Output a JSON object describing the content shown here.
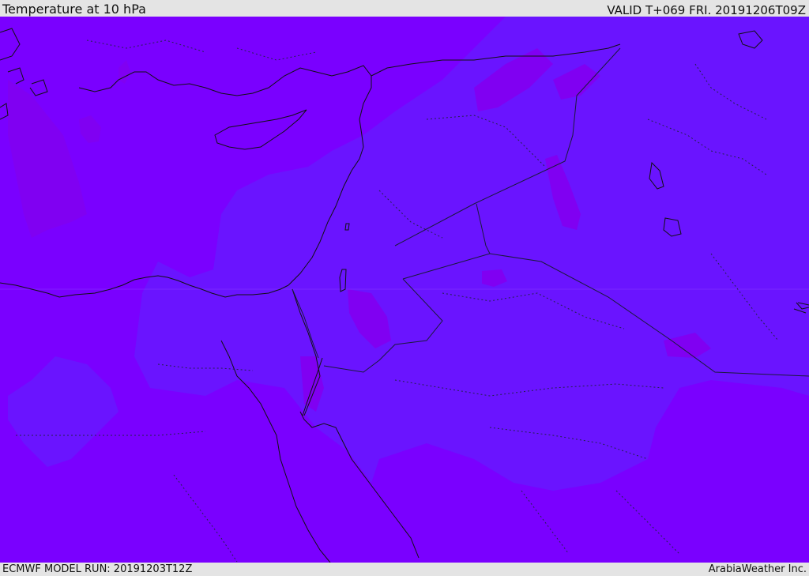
{
  "header": {
    "title": "Temperature at 10 hPa",
    "valid": "VALID T+069 FRI. 20191206T09Z"
  },
  "footer": {
    "model_run": "ECMWF MODEL RUN: 20191203T12Z",
    "credit": "ArabiaWeather Inc."
  },
  "map": {
    "field_colors": {
      "background": "#7a00ff",
      "mid_band": "#6a14ff",
      "warm_patch": "#8200f0",
      "cool_patch": "#5f1aff"
    },
    "coastline_color": "#111111",
    "border_color": "#222244"
  }
}
